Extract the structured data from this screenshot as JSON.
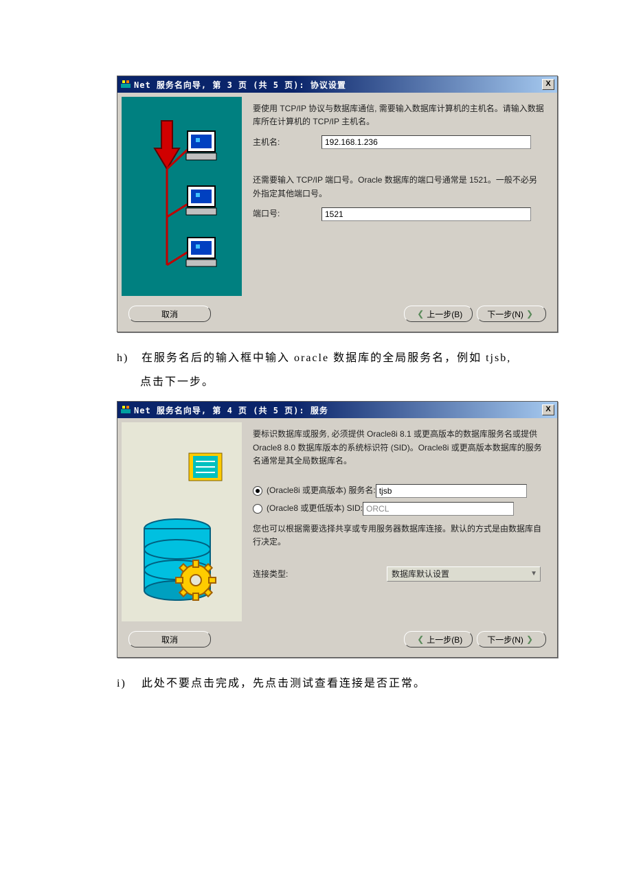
{
  "window1": {
    "title": "Net 服务名向导, 第 3 页 (共 5 页): 协议设置",
    "close_label": "X",
    "intro1": "要使用 TCP/IP 协议与数据库通信, 需要输入数据库计算机的主机名。请输入数据库所在计算机的 TCP/IP 主机名。",
    "host_label": "主机名:",
    "host_value": "192.168.1.236",
    "intro2": "还需要输入 TCP/IP 端口号。Oracle 数据库的端口号通常是 1521。一般不必另外指定其他端口号。",
    "port_label": "端口号:",
    "port_value": "1521",
    "cancel": "取消",
    "back": "上一步(B)",
    "next": "下一步(N)"
  },
  "para_h": {
    "letter": "h)",
    "line1": "在服务名后的输入框中输入 oracle 数据库的全局服务名，例如 tjsb,",
    "line2": "点击下一步。"
  },
  "window2": {
    "title": "Net 服务名向导, 第 4 页 (共 5 页): 服务",
    "close_label": "X",
    "intro": "要标识数据库或服务, 必须提供 Oracle8i 8.1 或更高版本的数据库服务名或提供 Oracle8 8.0 数据库版本的系统标识符 (SID)。Oracle8i 或更高版本数据库的服务名通常是其全局数据库名。",
    "opt1_label": "(Oracle8i 或更高版本) 服务名:",
    "opt1_value": "tjsb",
    "opt2_label": "(Oracle8 或更低版本) SID:",
    "opt2_value": "ORCL",
    "intro2": "您也可以根据需要选择共享或专用服务器数据库连接。默认的方式是由数据库自行决定。",
    "conn_label": "连接类型:",
    "conn_value": "数据库默认设置",
    "cancel": "取消",
    "back": "上一步(B)",
    "next": "下一步(N)"
  },
  "para_i": {
    "letter": "i)",
    "line1": "此处不要点击完成，先点击测试查看连接是否正常。"
  }
}
